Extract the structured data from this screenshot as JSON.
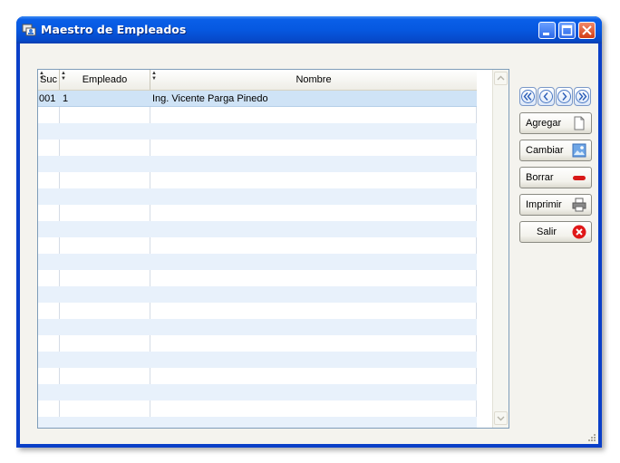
{
  "window": {
    "title": "Maestro de Empleados"
  },
  "grid": {
    "columns": [
      {
        "label": "Suc"
      },
      {
        "label": "Empleado"
      },
      {
        "label": "Nombre"
      }
    ],
    "rows": [
      {
        "suc": "001",
        "empleado": "1",
        "nombre": "Ing. Vicente Parga Pinedo",
        "selected": true
      }
    ],
    "empty_rows": 20
  },
  "nav": [
    "first-icon",
    "prev-icon",
    "next-icon",
    "last-icon"
  ],
  "actions": {
    "agregar": "Agregar",
    "cambiar": "Cambiar",
    "borrar": "Borrar",
    "imprimir": "Imprimir",
    "salir": "Salir"
  },
  "colors": {
    "titlebar": "#0658e0",
    "row_alt": "#e8f1fb",
    "row_selected": "#cfe3f6",
    "close": "#d23c14"
  }
}
